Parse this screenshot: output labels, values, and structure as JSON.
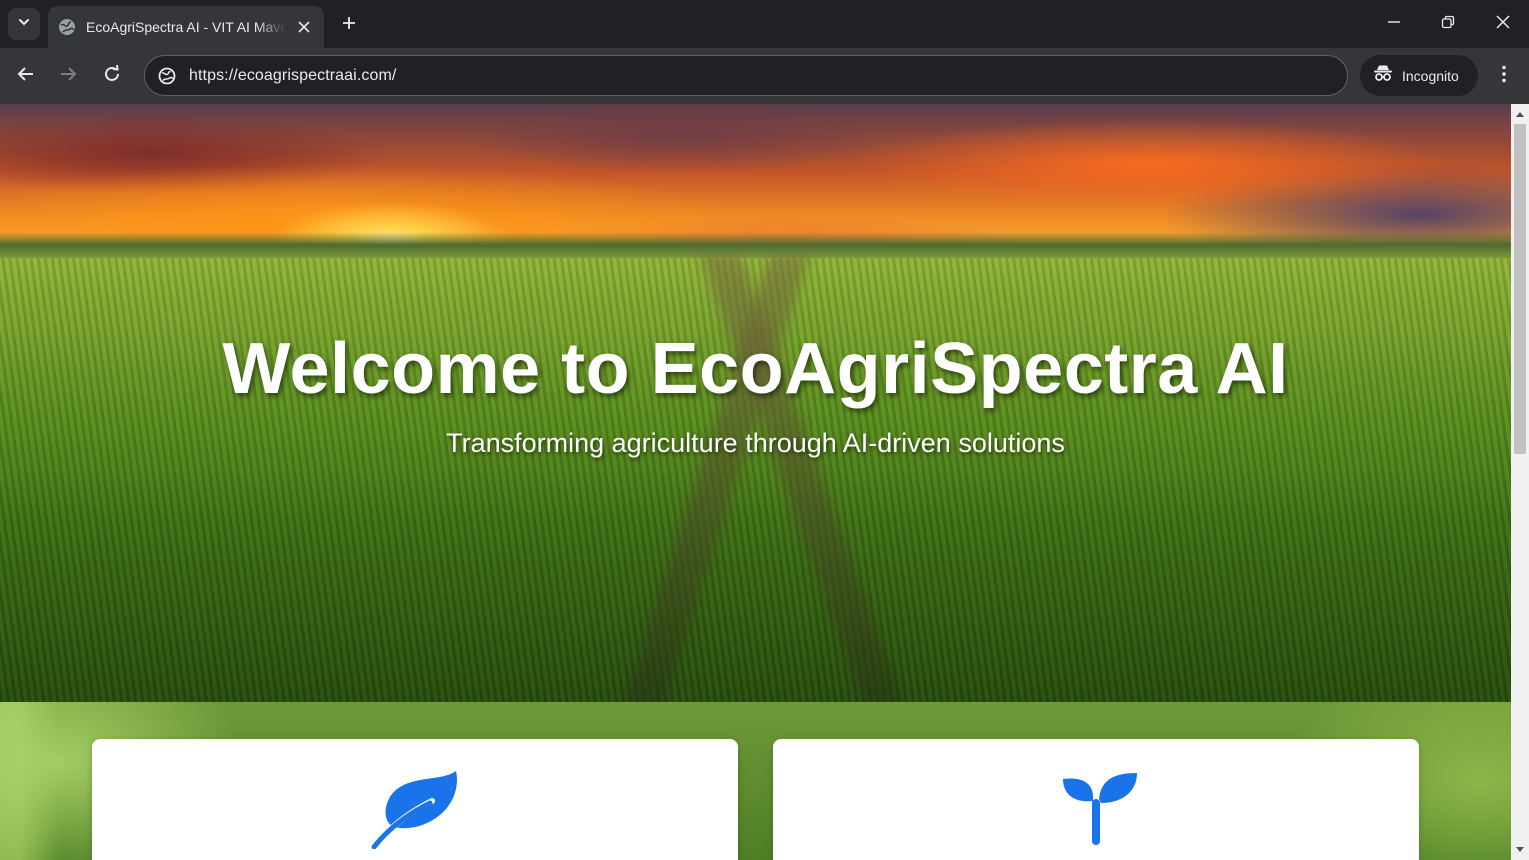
{
  "browser": {
    "tab": {
      "title": "EcoAgriSpectra AI - VIT AI Maverick"
    },
    "address_bar": {
      "url": "https://ecoagrispectraai.com/"
    },
    "incognito_label": "Incognito"
  },
  "icons": {
    "tab_search": "chevron-down-icon",
    "favicon": "globe-icon",
    "tab_close": "close-icon",
    "new_tab": "plus-icon",
    "minimize": "minimize-icon",
    "restore": "restore-icon",
    "close_window": "close-icon",
    "back": "back-arrow-icon",
    "forward": "forward-arrow-icon",
    "reload": "reload-icon",
    "site_info": "site-info-icon",
    "incognito": "incognito-icon",
    "menu": "kebab-menu-icon",
    "card1": "leaf-icon",
    "card2": "seedling-icon"
  },
  "colors": {
    "accent_icon": "#1a73e8"
  },
  "hero": {
    "title": "Welcome to EcoAgriSpectra AI",
    "subtitle": "Transforming agriculture through AI-driven solutions"
  }
}
